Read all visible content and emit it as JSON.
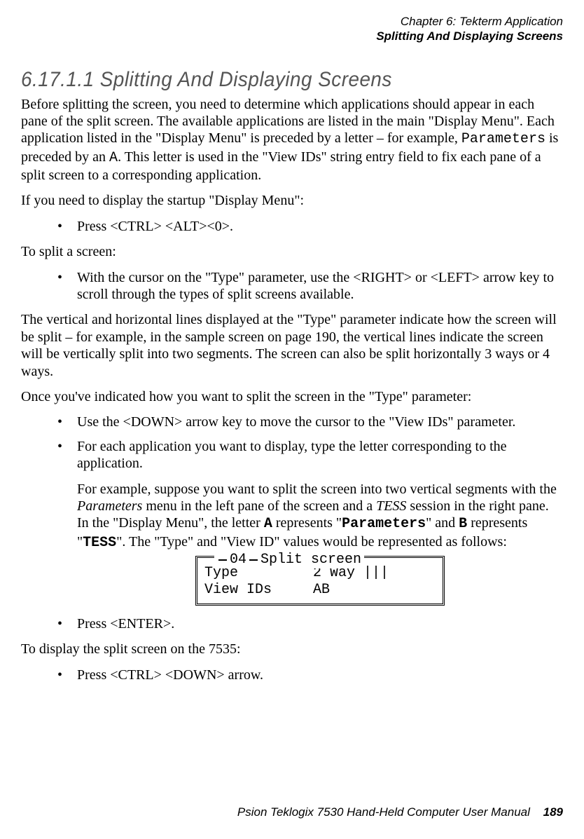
{
  "header": {
    "chapter": "Chapter   6:   Tekterm Application",
    "subtitle": "Splitting And Displaying Screens"
  },
  "heading": "6.17.1.1   Splitting And Displaying Screens",
  "p1_a": "Before splitting the screen, you need to determine which applications should appear in each pane of the split screen. The available applications are listed in the main \"Display Menu\". Each application listed in the \"Display Menu\" is preceded by a letter – for example, ",
  "p1_code1": "Parameters",
  "p1_b": " is preceded by an ",
  "p1_code2": "A",
  "p1_c": ". This letter is used in the \"View IDs\" string entry field to fix each pane of a split screen to a corresponding application.",
  "p2": "If you need to display the startup \"Display Menu\":",
  "b1": "Press <CTRL> <ALT><0>.",
  "p3": "To split a screen:",
  "b2": "With the cursor on the \"Type\" parameter, use the <RIGHT> or <LEFT> arrow key to scroll through the types of split screens available.",
  "p4": "The vertical and horizontal lines displayed at the \"Type\" parameter indicate how the screen will be split – for example, in the sample screen on page 190, the vertical lines indicate the screen will be vertically split into two segments. The screen can also be split horizontally 3 ways or 4 ways.",
  "p5": "Once you've indicated how you want to split the screen in the \"Type\" parameter:",
  "b3": "Use the <DOWN> arrow key to move the cursor to the \"View IDs\" parameter.",
  "b4": "For each application you want to display, type the letter corresponding to the application.",
  "b4sub_a": "For example, suppose you want to split the screen into two vertical segments with the ",
  "b4sub_ital1": "Parameters",
  "b4sub_b": " menu in the left pane of the screen and a ",
  "b4sub_ital2": "TESS",
  "b4sub_c": " session in the right pane. In the \"Display Menu\", the letter ",
  "b4sub_code1": "A",
  "b4sub_d": " represents \"",
  "b4sub_code2": "Parameters",
  "b4sub_e": "\" and ",
  "b4sub_code3": "B",
  "b4sub_f": " represents \"",
  "b4sub_code4": "TESS",
  "b4sub_g": "\". The \"Type\" and \"View ID\" values would be represented as follows:",
  "screen": {
    "num": "04",
    "title": "Split screen",
    "typeLabel": "Type",
    "typeValue": "2 Way |||",
    "viewLabel": "View IDs",
    "viewValue": "AB"
  },
  "b5": "Press <ENTER>.",
  "p6": "To display the split screen on the 7535:",
  "b6": "Press <CTRL> <DOWN> arrow.",
  "footer": {
    "title": "Psion Teklogix 7530 Hand-Held Computer User Manual",
    "page": "189"
  }
}
